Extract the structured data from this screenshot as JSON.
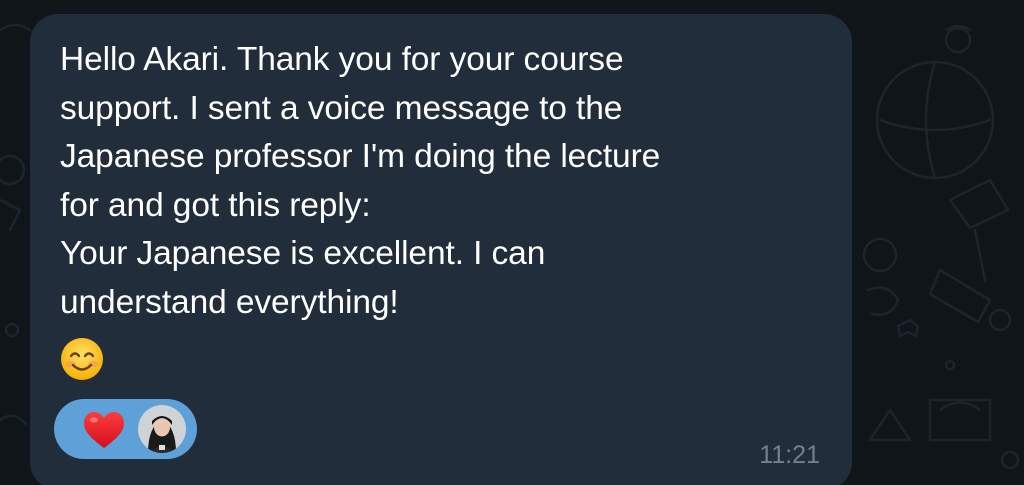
{
  "message": {
    "lines": [
      "Hello Akari. Thank you for your course",
      "support. I sent a voice message to the",
      "Japanese professor I'm doing the lecture",
      "for and got this reply:",
      "Your Japanese is excellent. I can",
      "understand everything!"
    ],
    "emoji": "smiling-face-with-smiling-eyes",
    "time": "11:21",
    "reaction": {
      "emoji": "red-heart",
      "by": "user-avatar"
    }
  },
  "colors": {
    "background": "#0f1519",
    "bubble": "#212d3b",
    "text": "#ffffff",
    "time": "#73818e",
    "reaction_pill": "#5ea0d8",
    "heart": "#e0202c"
  }
}
